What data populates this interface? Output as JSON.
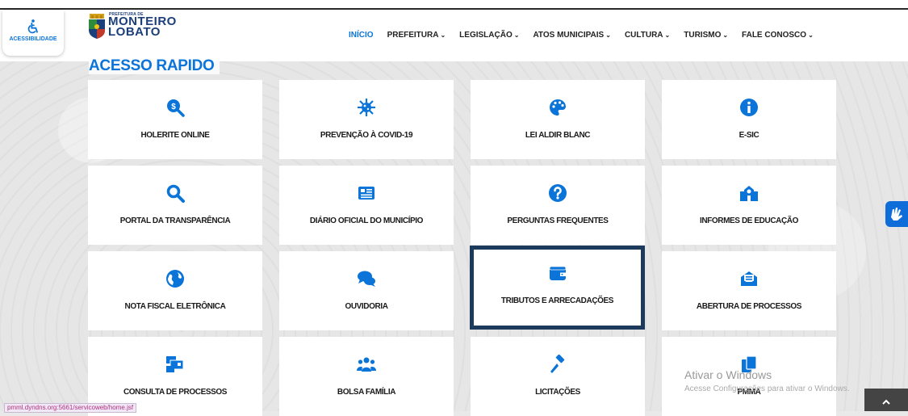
{
  "accessibility": {
    "label": "ACESSIBILIDADE"
  },
  "logo": {
    "small": "PREFEITURA DE",
    "line1": "MONTEIRO",
    "line2": "LOBATO"
  },
  "nav": [
    {
      "label": "INÍCIO",
      "active": true,
      "chevron": ""
    },
    {
      "label": "PREFEITURA",
      "active": false,
      "chevron": "⌄"
    },
    {
      "label": "LEGISLAÇÃO",
      "active": false,
      "chevron": "⌄"
    },
    {
      "label": "ATOS MUNICIPAIS",
      "active": false,
      "chevron": "⌄"
    },
    {
      "label": "CULTURA",
      "active": false,
      "chevron": "⌄"
    },
    {
      "label": "TURISMO",
      "active": false,
      "chevron": "⌄"
    },
    {
      "label": "FALE CONOSCO",
      "active": false,
      "chevron": "⌄"
    }
  ],
  "section": {
    "title": "ACESSO RAPIDO"
  },
  "cards": [
    {
      "label": "HOLERITE ONLINE",
      "icon": "search-dollar-icon"
    },
    {
      "label": "PREVENÇÃO À COVID-19",
      "icon": "virus-icon"
    },
    {
      "label": "LEI ALDIR BLANC",
      "icon": "palette-icon"
    },
    {
      "label": "E-SIC",
      "icon": "info-icon"
    },
    {
      "label": "PORTAL DA TRANSPARÊNCIA",
      "icon": "search-icon"
    },
    {
      "label": "DIÁRIO OFICIAL DO MUNICÍPIO",
      "icon": "newspaper-icon"
    },
    {
      "label": "PERGUNTAS FREQUENTES",
      "icon": "question-icon"
    },
    {
      "label": "INFORMES DE EDUCAÇÃO",
      "icon": "school-icon"
    },
    {
      "label": "NOTA FISCAL ELETRÔNICA",
      "icon": "globe-icon"
    },
    {
      "label": "OUVIDORIA",
      "icon": "comments-icon"
    },
    {
      "label": "TRIBUTOS E ARRECADAÇÕES",
      "icon": "wallet-icon",
      "selected": true
    },
    {
      "label": "ABERTURA DE PROCESSOS",
      "icon": "envelope-open-icon"
    },
    {
      "label": "CONSULTA DE PROCESSOS",
      "icon": "mail-bulk-icon"
    },
    {
      "label": "BOLSA FAMÍLIA",
      "icon": "users-icon"
    },
    {
      "label": "LICITAÇÕES",
      "icon": "gavel-icon"
    },
    {
      "label": "PMMA",
      "icon": "copy-icon"
    }
  ],
  "watermark": {
    "line1": "Ativar o Windows",
    "line2": "Acesse Configurações para ativar o Windows."
  },
  "status_url": "pmml.dyndns.org:5661/servicoweb/home.jsf",
  "colors": {
    "accent": "#0a74d9",
    "selected_border": "#1b3a5c",
    "text": "#1a1a1a"
  }
}
